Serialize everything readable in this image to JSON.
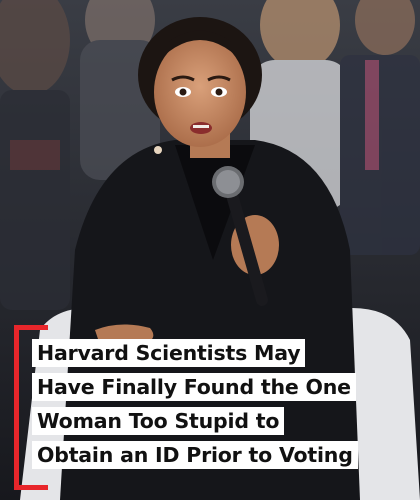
{
  "caption": {
    "lines": [
      "Harvard Scientists May",
      "Have Finally Found the One",
      "Woman Too Stupid to",
      "Obtain an ID Prior to Voting"
    ]
  },
  "colors": {
    "accent": "#e8262b",
    "caption_background": "#ffffff",
    "caption_text": "#111111",
    "jacket": "#15161a",
    "background": "#2a2d35"
  },
  "icons": {
    "microphone": "microphone-icon"
  }
}
